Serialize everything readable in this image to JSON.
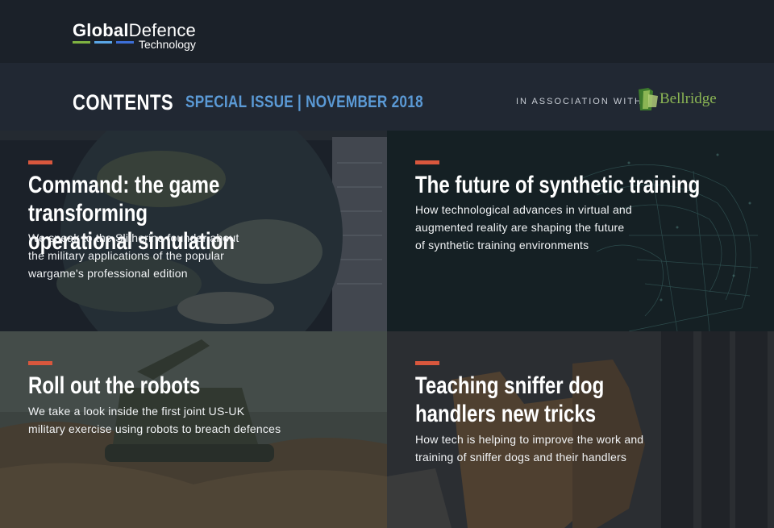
{
  "brand": {
    "logo_word1": "Global",
    "logo_word2": "Defence",
    "logo_word3": "Technology",
    "bar_colors": [
      "#7fb241",
      "#5aa6e6",
      "#3d6fd8"
    ]
  },
  "header": {
    "contents_label": "CONTENTS",
    "issue_label": "SPECIAL ISSUE | NOVEMBER 2018",
    "association_label": "IN ASSOCIATION WITH",
    "partner_name": "Bellridge"
  },
  "colors": {
    "accent": "#d9573d",
    "issue_text": "#5b9ad6",
    "partner_green": "#8bb554",
    "background": "#1b2129"
  },
  "articles": [
    {
      "title_line1": "Command: the game transforming",
      "title_line2": "operational simulation",
      "desc_line1": "We speak to the Slitherine founder about",
      "desc_line2": "the military applications of the popular",
      "desc_line3": "wargame's professional edition",
      "image": "globe-simulation-screenshot"
    },
    {
      "title_line1": "The future of synthetic training",
      "desc_line1": "How technological advances in virtual and",
      "desc_line2": "augmented reality are shaping the future",
      "desc_line3": "of synthetic training environments",
      "image": "vr-headset-wireframe"
    },
    {
      "title_line1": "Roll out the robots",
      "desc_line1": "We take a look inside the first joint US-UK",
      "desc_line2": "military exercise using robots to breach defences",
      "image": "tracked-robot-vehicle"
    },
    {
      "title_line1": "Teaching sniffer dog",
      "title_line2": "handlers new tricks",
      "desc_line1": "How tech is helping to improve the work and",
      "desc_line2": "training of sniffer dogs and their handlers",
      "image": "sniffer-dogs-with-soldiers"
    }
  ]
}
